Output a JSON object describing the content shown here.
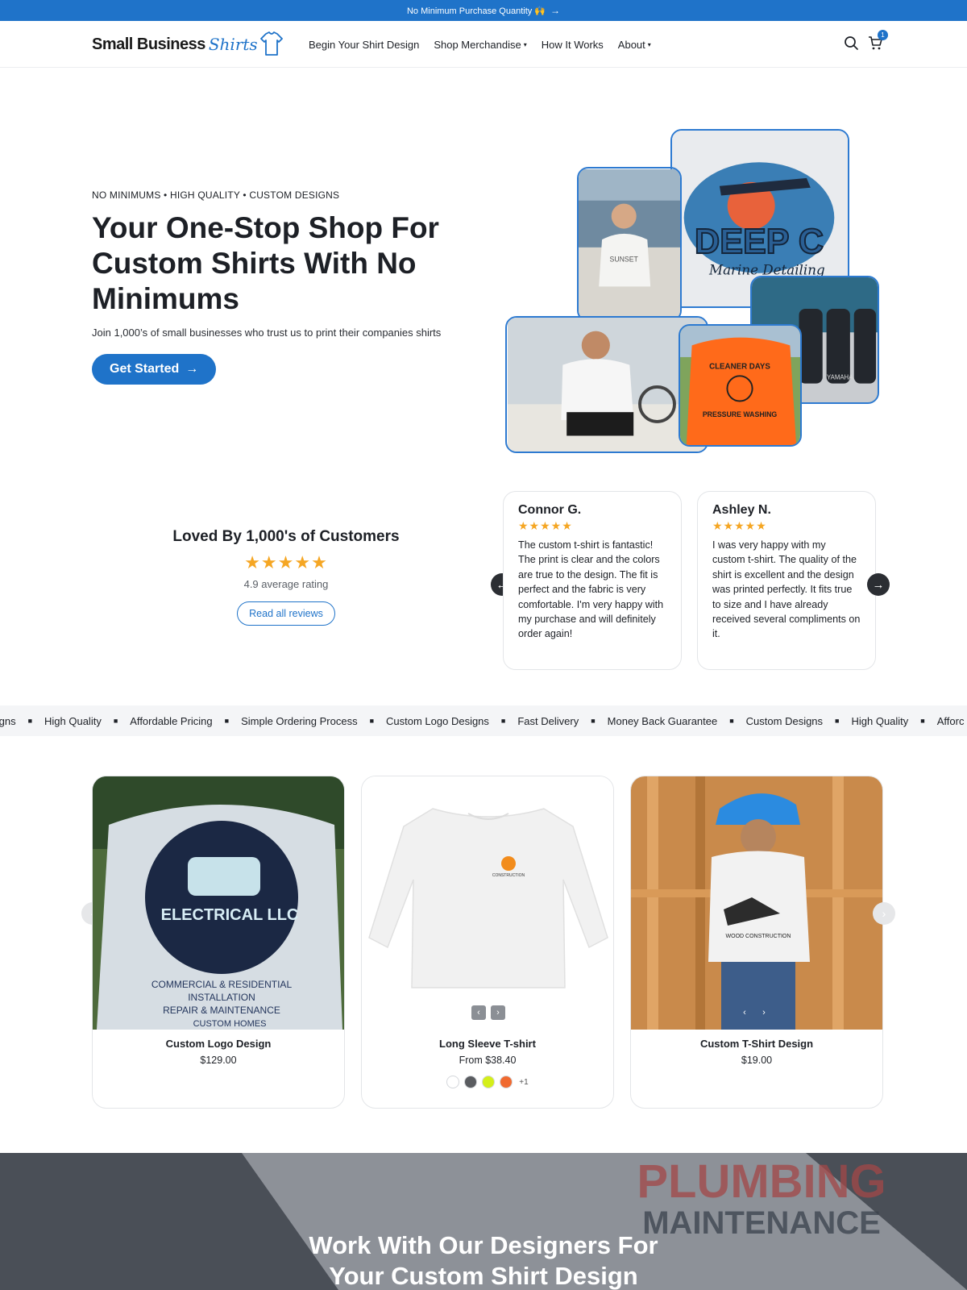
{
  "announcement": {
    "text": "No Minimum Purchase Quantity 🙌",
    "arrow": "→"
  },
  "header": {
    "logo": {
      "part1": "Small Business",
      "part2": "Shirts",
      "icon": "tshirt-logo-icon"
    },
    "nav": [
      {
        "label": "Begin Your Shirt Design",
        "has_caret": false
      },
      {
        "label": "Shop Merchandise",
        "has_caret": true
      },
      {
        "label": "How It Works",
        "has_caret": false
      },
      {
        "label": "About",
        "has_caret": true
      }
    ],
    "caret": "▾",
    "cart_count": "1",
    "icons": [
      "search-icon",
      "cart-icon"
    ]
  },
  "hero": {
    "eyebrow": "NO MINIMUMS • HIGH QUALITY • CUSTOM DESIGNS",
    "title": "Your One-Stop Shop For Custom Shirts With No Minimums",
    "subtitle": "Join 1,000’s of small businesses who trust us to print their companies shirts",
    "cta": "Get Started",
    "cta_arrow": "→",
    "collage_texts": {
      "deepc_1": "DEEP C",
      "deepc_2": "Marine Detailing",
      "sunset": "SUNSET",
      "cleaner": "CLEANER DAYS",
      "pressure": "PRESSURE WASHING",
      "yamaha": "YAMAHA"
    }
  },
  "reviews": {
    "heading": "Loved By 1,000's of Customers",
    "stars": "★★★★★",
    "average": "4.9 average rating",
    "read_all": "Read all reviews",
    "prev": "←",
    "next": "→",
    "items": [
      {
        "name": "Connor G.",
        "stars": "★★★★★",
        "text": "The custom t-shirt is fantastic! The print is clear and the colors are true to the design. The fit is perfect and the fabric is very comfortable. I'm very happy with my purchase and will definitely order again!"
      },
      {
        "name": "Ashley N.",
        "stars": "★★★★★",
        "text": "I was very happy with my custom t-shirt. The quality of the shirt is excellent and the design was printed perfectly. It fits true to size and I have already received several compliments on it."
      }
    ]
  },
  "ticker": {
    "items": [
      "esigns",
      "High Quality",
      "Affordable Pricing",
      "Simple Ordering Process",
      "Custom Logo Designs",
      "Fast Delivery",
      "Money Back Guarantee",
      "Custom Designs",
      "High Quality",
      "Afforc"
    ],
    "separator": "■"
  },
  "products": {
    "prev": "‹",
    "next": "›",
    "items": [
      {
        "name": "Custom Logo Design",
        "price": "$129.00",
        "img_text_1": "ELECTRICAL LLC",
        "img_text_2": "COMMERCIAL & RESIDENTIAL",
        "img_text_3": "INSTALLATION",
        "img_text_4": "REPAIR & MAINTENANCE",
        "img_text_5": "CUSTOM HOMES"
      },
      {
        "name": "Long Sleeve T-shirt",
        "price": "From $38.40",
        "swatches": [
          "#ffffff",
          "#5a5c60",
          "#d4ef1a",
          "#f06a30"
        ],
        "more": "+1",
        "img_text_1": "CONSTRUCTION"
      },
      {
        "name": "Custom T-Shirt Design",
        "price": "$19.00",
        "img_text_1": "WOOD CONSTRUCTION"
      }
    ]
  },
  "banner": {
    "title_line1": "Work With Our Designers For",
    "title_line2": "Your Custom Shirt Design",
    "bg_text_1": "PLUMBING",
    "bg_text_2": "MAINTENANCE"
  },
  "colors": {
    "primary": "#1f73c9",
    "star": "#f5a623",
    "dark": "#1d2026"
  }
}
